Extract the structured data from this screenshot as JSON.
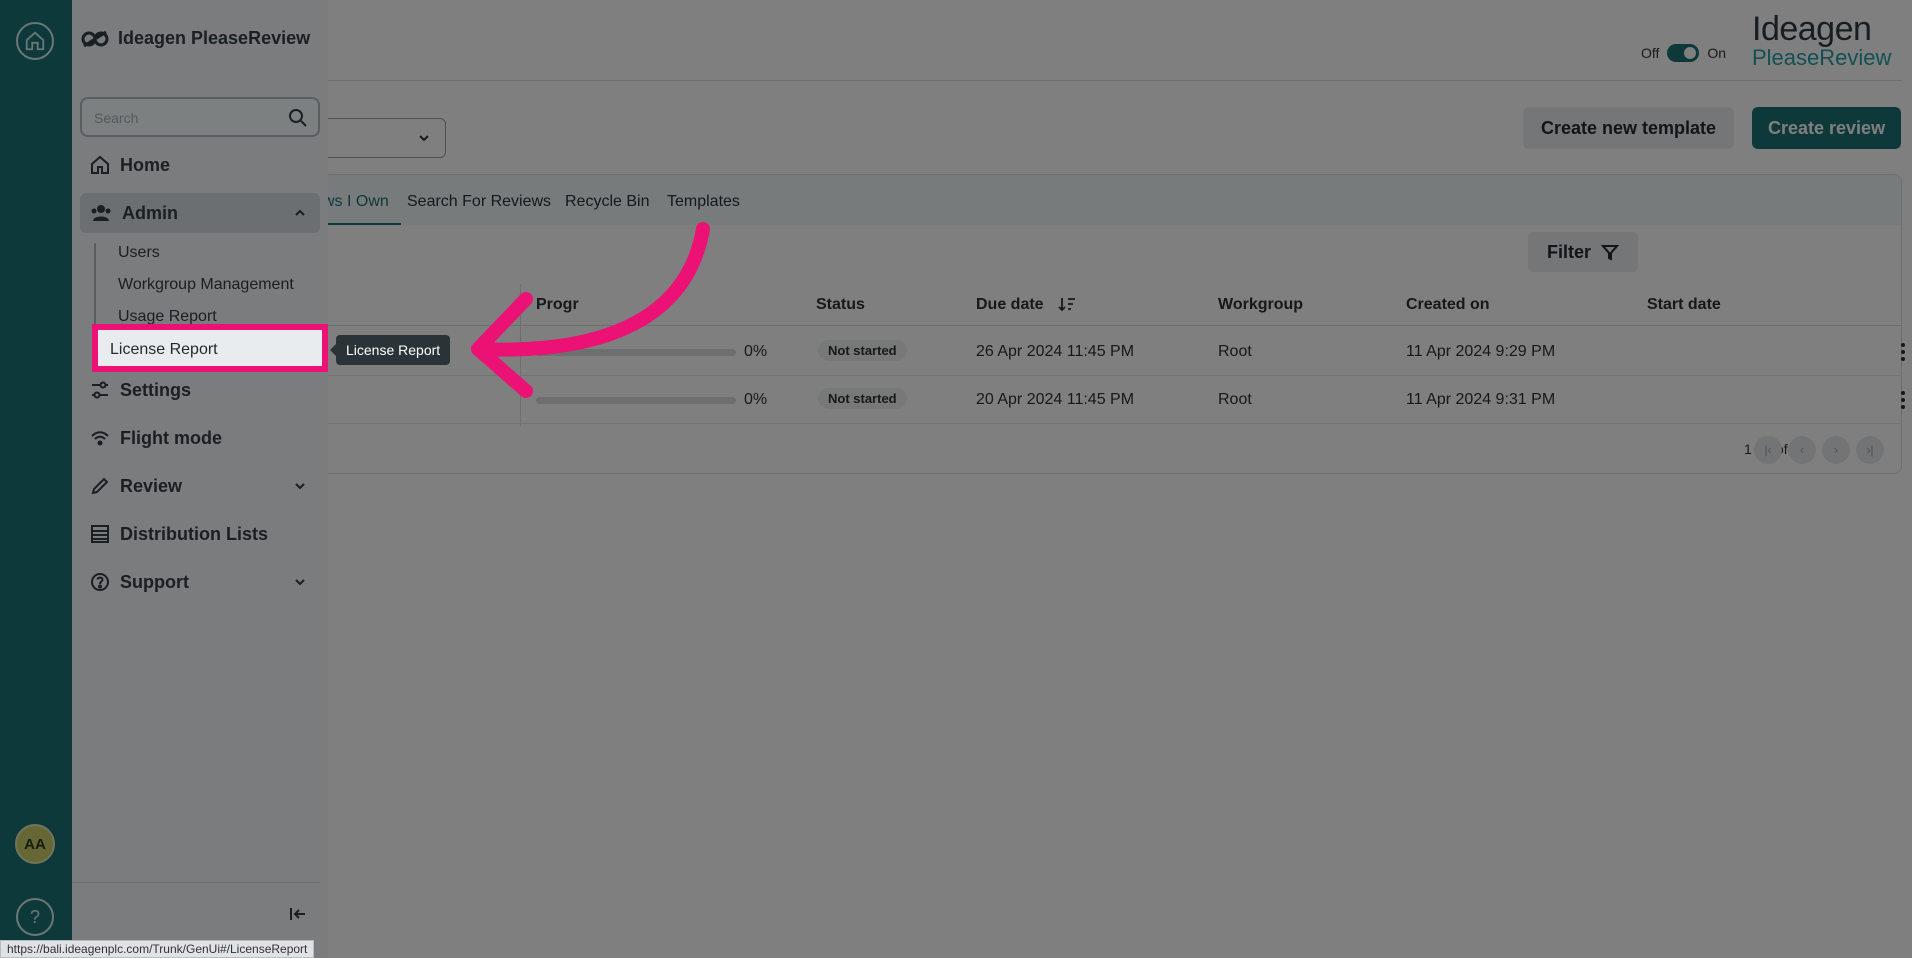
{
  "app": {
    "brand": "Ideagen PleaseReview",
    "logo_top": "Ideagen",
    "logo_bottom": "PleaseReview"
  },
  "toggle": {
    "off_label": "Off",
    "on_label": "On",
    "state": "on"
  },
  "buttons": {
    "create_template": "Create new template",
    "create_review": "Create review",
    "filter": "Filter"
  },
  "tabs": [
    {
      "label": "ws I Own",
      "active": true
    },
    {
      "label": "Search For Reviews",
      "active": false
    },
    {
      "label": "Recycle Bin",
      "active": false
    },
    {
      "label": "Templates",
      "active": false
    }
  ],
  "table": {
    "headers": {
      "progress": "Progr",
      "status": "Status",
      "due_date": "Due date",
      "workgroup": "Workgroup",
      "created_on": "Created on",
      "start_date": "Start date"
    },
    "rows": [
      {
        "progress": "0%",
        "status": "Not started",
        "due_date": "26 Apr 2024 11:45 PM",
        "workgroup": "Root",
        "created_on": "11 Apr 2024 9:29 PM",
        "start_date": ""
      },
      {
        "progress": "0%",
        "status": "Not started",
        "due_date": "20 Apr 2024 11:45 PM",
        "workgroup": "Root",
        "created_on": "11 Apr 2024 9:31 PM",
        "start_date": ""
      }
    ],
    "pagination": "1 - 2 of 2"
  },
  "menu": {
    "search_placeholder": "Search",
    "items": {
      "home": "Home",
      "admin": "Admin",
      "settings": "Settings",
      "flight_mode": "Flight mode",
      "review": "Review",
      "distribution_lists": "Distribution Lists",
      "support": "Support"
    },
    "admin_sub": {
      "users": "Users",
      "workgroup_management": "Workgroup Management",
      "usage_report": "Usage Report",
      "license_report": "License Report"
    }
  },
  "tooltip": "License Report",
  "user": {
    "initials": "AA"
  },
  "status_url": "https://bali.ideagenplc.com/Trunk/GenUi#/LicenseReport",
  "colors": {
    "accent": "#1d7376",
    "highlight": "#ec1174",
    "brand_teal": "#23a1a6"
  }
}
